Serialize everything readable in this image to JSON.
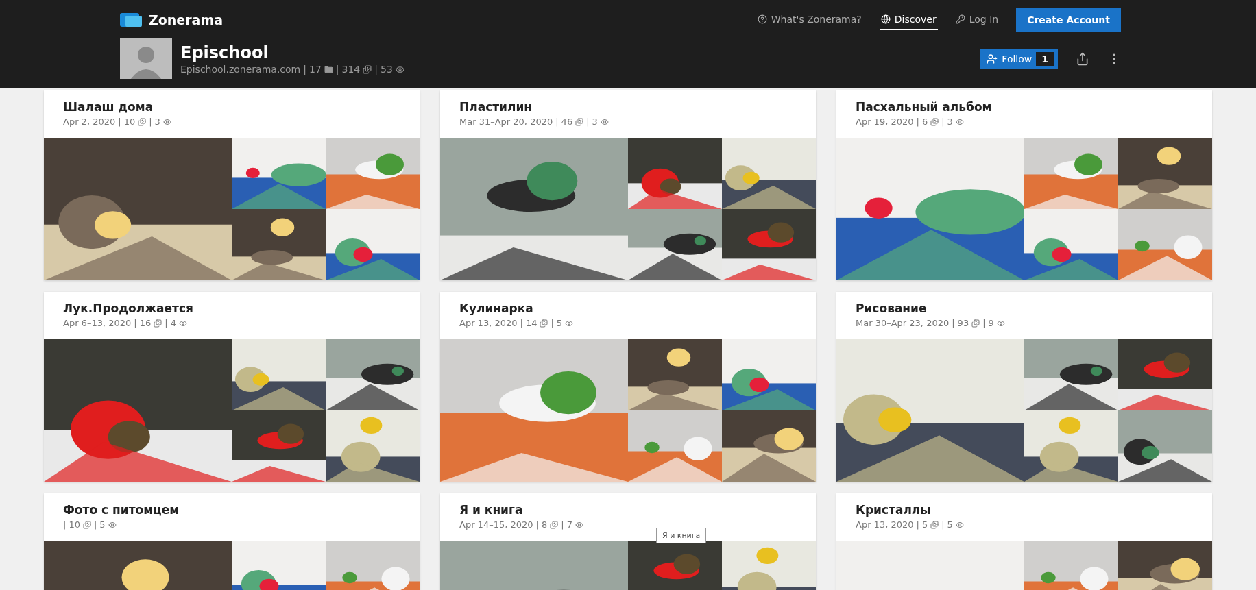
{
  "separator": "|",
  "header": {
    "logo": "Zonerama",
    "nav": [
      {
        "label": "What's Zonerama?",
        "kind": "help",
        "selected": false
      },
      {
        "label": "Discover",
        "kind": "globe",
        "selected": true
      },
      {
        "label": "Log In",
        "kind": "key",
        "selected": false
      }
    ],
    "create_account": "Create Account"
  },
  "profile": {
    "name": "Epischool",
    "domain": "Epischool.zonerama.com",
    "albums": "17",
    "photos": "314",
    "views": "53",
    "follow": {
      "label": "Follow",
      "count": "1"
    }
  },
  "albums": [
    {
      "title": "Шалаш дома",
      "date": "Apr 2, 2020",
      "photos": "10",
      "views": "3"
    },
    {
      "title": "Пластилин",
      "date": "Mar 31–Apr 20, 2020",
      "photos": "46",
      "views": "3"
    },
    {
      "title": "Пасхальный альбом",
      "date": "Apr 19, 2020",
      "photos": "6",
      "views": "3"
    },
    {
      "title": "Лук.Продолжается",
      "date": "Apr 6–13, 2020",
      "photos": "16",
      "views": "4"
    },
    {
      "title": "Кулинарка",
      "date": "Apr 13, 2020",
      "photos": "14",
      "views": "5"
    },
    {
      "title": "Рисование",
      "date": "Mar 30–Apr 23, 2020",
      "photos": "93",
      "views": "9"
    },
    {
      "title": "Фото с питомцем",
      "photos": "10",
      "views": "5"
    },
    {
      "title": "Я и книга",
      "date": "Apr 14–15, 2020",
      "photos": "8",
      "views": "7",
      "tooltip": "Я и книга"
    },
    {
      "title": "Кристаллы",
      "date": "Apr 13, 2020",
      "photos": "5",
      "views": "5"
    }
  ]
}
